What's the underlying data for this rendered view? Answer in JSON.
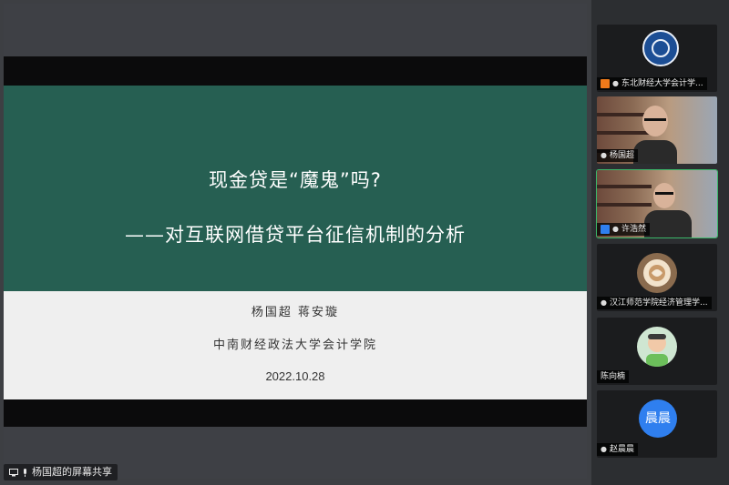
{
  "slide": {
    "title": "现金贷是“魔鬼”吗?",
    "subtitle": "——对互联网借贷平台征信机制的分析",
    "authors": "杨国超  蒋安璇",
    "school": "中南财经政法大学会计学院",
    "date": "2022.10.28"
  },
  "share_label": "杨国超的屏幕共享",
  "participants": [
    {
      "name": "东北财经大学会计学..."
    },
    {
      "name": "杨国超"
    },
    {
      "name": "许浩然"
    },
    {
      "name": "汉江师范学院经济管理学..."
    },
    {
      "name": "陈向楠"
    },
    {
      "name": "赵晨晨",
      "avatar_text": "晨晨"
    }
  ],
  "colors": {
    "slide_green": "#265f52",
    "host_badge": "#f07a1a",
    "cohost_badge": "#2f7fef",
    "avatar_blue": "#2f7fef"
  }
}
